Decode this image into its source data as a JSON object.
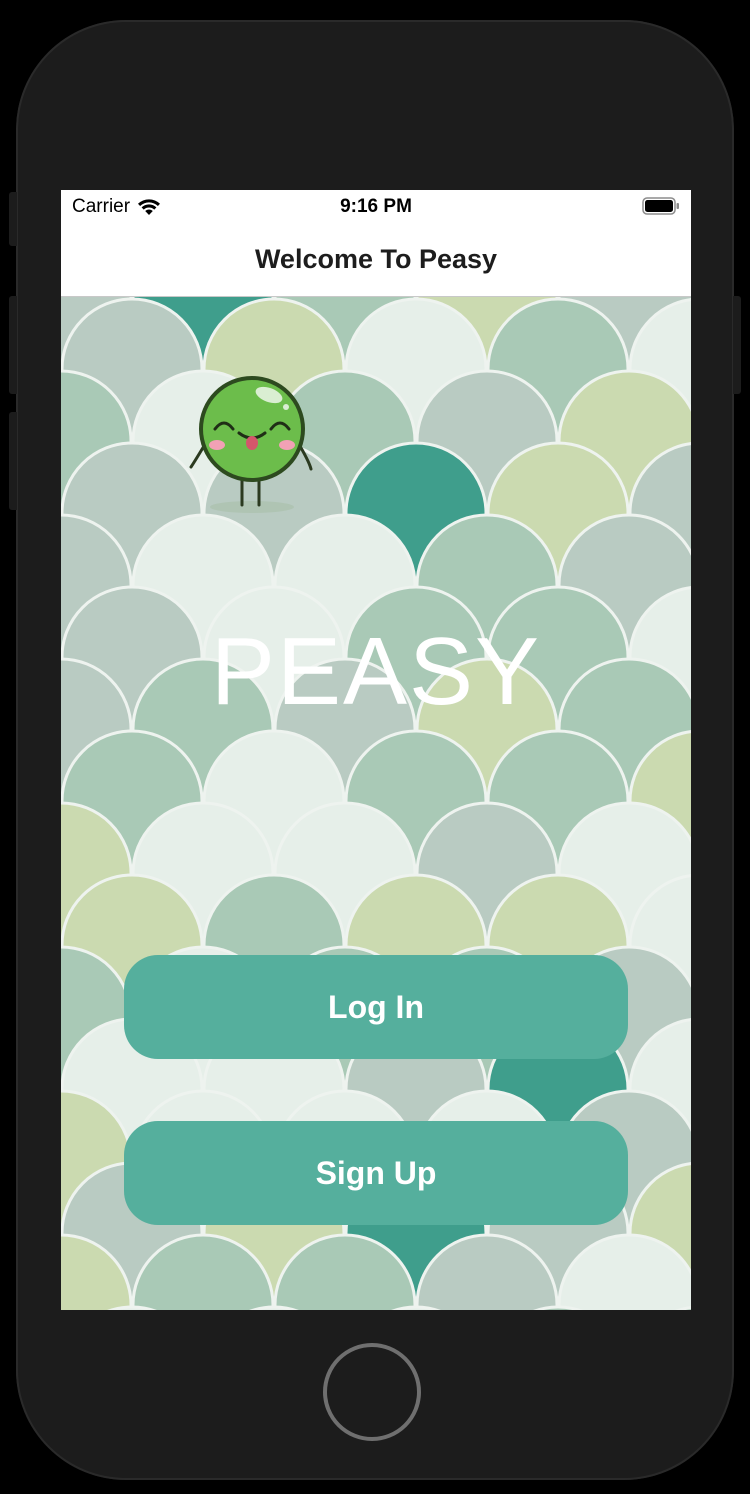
{
  "status_bar": {
    "carrier": "Carrier",
    "time": "9:16 PM",
    "icons": [
      "wifi-icon",
      "battery-icon"
    ]
  },
  "nav": {
    "title": "Welcome To Peasy"
  },
  "main": {
    "logo_text": "PEASY",
    "login_label": "Log In",
    "signup_label": "Sign Up",
    "mascot": "pea-mascot-icon"
  },
  "colors": {
    "button": "#55af9d",
    "teal_scale": "#3f9e8c",
    "mint_scale": "#a9c9b6",
    "pale_scale": "#e6efe9",
    "olive_scale": "#cbdab0",
    "gray_scale": "#b9cbc2",
    "mascot_green": "#6cbd4b"
  }
}
